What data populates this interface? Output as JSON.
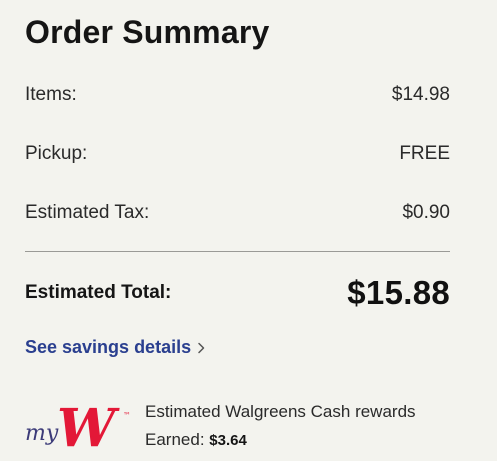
{
  "order_summary": {
    "title": "Order Summary",
    "items_label": "Items:",
    "items_value": "$14.98",
    "pickup_label": "Pickup:",
    "pickup_value": "FREE",
    "tax_label": "Estimated Tax:",
    "tax_value": "$0.90",
    "total_label": "Estimated Total:",
    "total_value": "$15.88",
    "savings_link": "See savings details"
  },
  "rewards": {
    "logo_text_my": "my",
    "logo_text_w": "W",
    "logo_trademark": "™",
    "description": "Estimated Walgreens Cash rewards",
    "earned_label": "Earned:",
    "earned_value": "$3.64"
  },
  "colors": {
    "background": "#f3f3ee",
    "link": "#2a3f8f",
    "brand_red": "#e31837",
    "logo_navy": "#3b3a78"
  },
  "icons": {
    "savings_chevron": "chevron-right-icon"
  }
}
